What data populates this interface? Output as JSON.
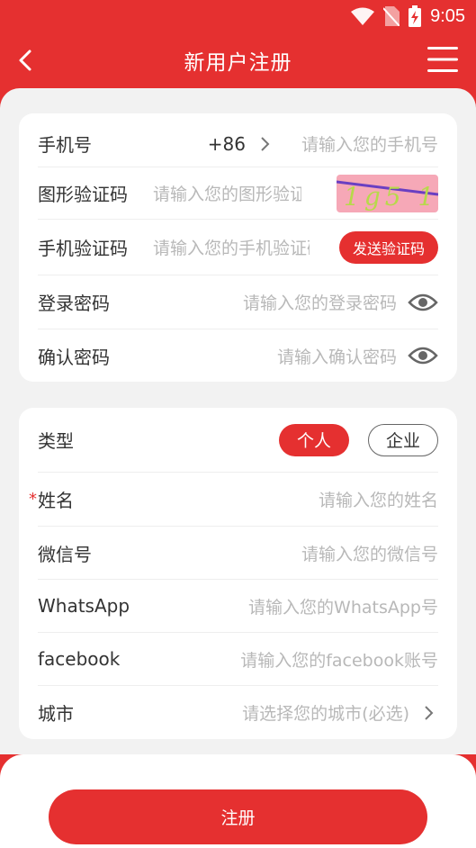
{
  "status": {
    "time": "9:05"
  },
  "nav": {
    "title": "新用户注册"
  },
  "phone": {
    "label": "手机号",
    "code": "+86",
    "placeholder": "请输入您的手机号"
  },
  "captcha": {
    "label": "图形验证码",
    "placeholder": "请输入您的图形验证码",
    "image_text": "1g5 1"
  },
  "sms": {
    "label": "手机验证码",
    "placeholder": "请输入您的手机验证码",
    "button": "发送验证码"
  },
  "password": {
    "label": "登录密码",
    "placeholder": "请输入您的登录密码"
  },
  "confirm": {
    "label": "确认密码",
    "placeholder": "请输入确认密码"
  },
  "type": {
    "label": "类型",
    "options": [
      "个人",
      "企业"
    ],
    "selected": "个人"
  },
  "name": {
    "required_mark": "*",
    "label": "姓名",
    "placeholder": "请输入您的姓名"
  },
  "wechat": {
    "label": "微信号",
    "placeholder": "请输入您的微信号"
  },
  "whatsapp": {
    "label": "WhatsApp",
    "placeholder": "请输入您的WhatsApp号"
  },
  "facebook": {
    "label": "facebook",
    "placeholder": "请输入您的facebook账号"
  },
  "city": {
    "label": "城市",
    "placeholder": "请选择您的城市(必选)"
  },
  "submit": {
    "label": "注册"
  },
  "colors": {
    "accent": "#e53030",
    "background": "#f2f2f2",
    "placeholder": "#b8b8b8"
  }
}
